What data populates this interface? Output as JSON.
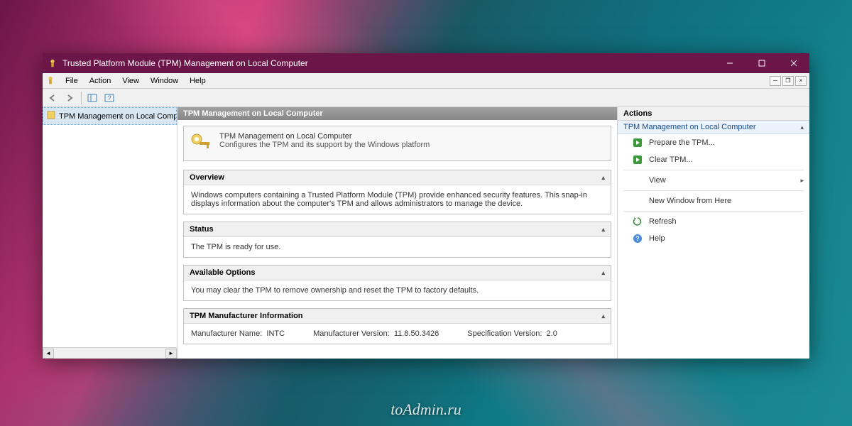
{
  "window": {
    "title": "Trusted Platform Module (TPM) Management on Local Computer"
  },
  "menubar": {
    "items": [
      "File",
      "Action",
      "View",
      "Window",
      "Help"
    ]
  },
  "tree": {
    "root": "TPM Management on Local Comp"
  },
  "main": {
    "header": "TPM Management on Local Computer",
    "intro": {
      "title": "TPM Management on Local Computer",
      "subtitle": "Configures the TPM and its support by the Windows platform"
    },
    "sections": {
      "overview": {
        "title": "Overview",
        "body": "Windows computers containing a Trusted Platform Module (TPM) provide enhanced security features. This snap-in displays information about the computer's TPM and allows administrators to manage the device."
      },
      "status": {
        "title": "Status",
        "body": "The TPM is ready for use."
      },
      "options": {
        "title": "Available Options",
        "body": "You may clear the TPM to remove ownership and reset the TPM to factory defaults."
      },
      "mfr": {
        "title": "TPM Manufacturer Information",
        "name_label": "Manufacturer Name:",
        "name_value": "INTC",
        "version_label": "Manufacturer Version:",
        "version_value": "11.8.50.3426",
        "spec_label": "Specification Version:",
        "spec_value": "2.0"
      }
    }
  },
  "actions": {
    "title": "Actions",
    "subtitle": "TPM Management on Local Computer",
    "items": {
      "prepare": "Prepare the TPM...",
      "clear": "Clear TPM...",
      "view": "View",
      "new_window": "New Window from Here",
      "refresh": "Refresh",
      "help": "Help"
    }
  },
  "watermark": "toAdmin.ru"
}
